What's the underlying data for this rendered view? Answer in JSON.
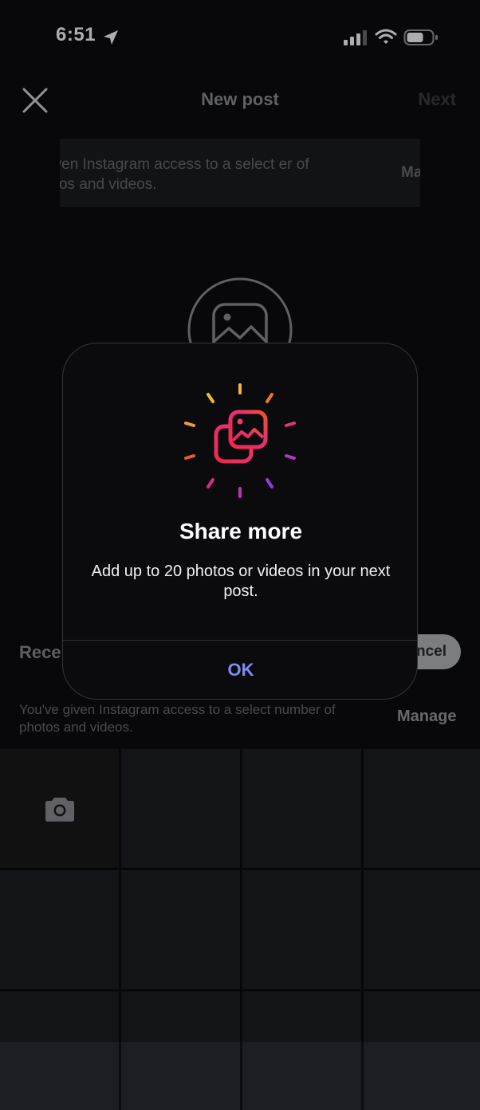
{
  "status_bar": {
    "time": "6:51"
  },
  "header": {
    "title": "New post",
    "next_label": "Next"
  },
  "top_banner": {
    "text": "e given Instagram access to a select er of photos and videos.",
    "manage_label": "Ma"
  },
  "recents": {
    "label": "Rece",
    "cancel_label": "ncel"
  },
  "access_note": {
    "text": "You've given Instagram access to a select number of photos and videos.",
    "manage_label": "Manage"
  },
  "modal": {
    "title": "Share more",
    "body": "Add up to 20 photos or videos in your next post.",
    "ok_label": "OK",
    "icon": "multi-photo-icon"
  },
  "colors": {
    "accent_ok": "#7c8ef0",
    "background": "#0c0d10",
    "grid_cell": "#1c1e23"
  },
  "icons": [
    "location-arrow-icon",
    "signal-icon",
    "wifi-icon",
    "battery-icon",
    "close-icon",
    "photo-icon",
    "camera-icon",
    "multi-photo-icon"
  ]
}
